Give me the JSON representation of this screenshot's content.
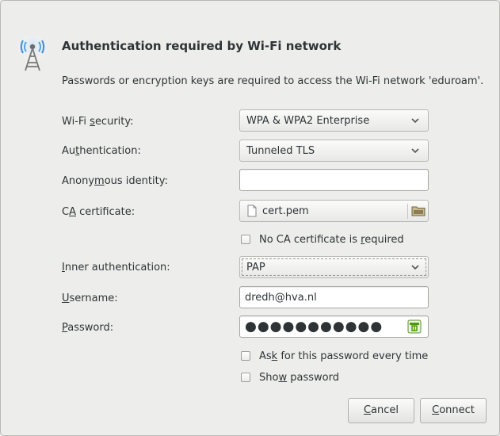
{
  "dialog": {
    "title": "Authentication required by Wi-Fi network",
    "subtitle": "Passwords or encryption keys are required to access the Wi-Fi network 'eduroam'."
  },
  "icons": {
    "header": "wireless-access-point-icon",
    "combo_arrow": "chevron-down-icon",
    "file": "document-icon",
    "folder": "folder-icon",
    "password_toggle": "keyboard-icon"
  },
  "form": {
    "wifi_security": {
      "label_pre": "Wi-Fi ",
      "label_u": "s",
      "label_post": "ecurity:",
      "value": "WPA & WPA2 Enterprise"
    },
    "authentication": {
      "label_pre": "Au",
      "label_u": "t",
      "label_post": "hentication:",
      "value": "Tunneled TLS"
    },
    "anonymous_identity": {
      "label_pre": "Anony",
      "label_u": "m",
      "label_post": "ous identity:",
      "value": ""
    },
    "ca_certificate": {
      "label_pre": "C",
      "label_u": "A",
      "label_post": " certificate:",
      "value": "cert.pem"
    },
    "no_ca_required": {
      "label_pre": "No CA certificate is ",
      "label_u": "r",
      "label_post": "equired",
      "checked": false
    },
    "inner_authentication": {
      "label_pre": "",
      "label_u": "I",
      "label_post": "nner authentication:",
      "value": "PAP"
    },
    "username": {
      "label_pre": "",
      "label_u": "U",
      "label_post": "sername:",
      "value": "dredh@hva.nl"
    },
    "password": {
      "label_pre": "",
      "label_u": "P",
      "label_post": "assword:",
      "value": "●●●●●●●●●●●"
    },
    "ask_password": {
      "label_pre": "As",
      "label_u": "k",
      "label_post": " for this password every time",
      "checked": false
    },
    "show_password": {
      "label_pre": "Sho",
      "label_u": "w",
      "label_post": " password",
      "checked": false
    }
  },
  "buttons": {
    "cancel": {
      "label_pre": "",
      "label_u": "C",
      "label_post": "ancel"
    },
    "connect": {
      "label_pre": "",
      "label_u": "C",
      "label_post": "onnect"
    }
  },
  "colors": {
    "background": "#ededeb",
    "text": "#2e3436",
    "border": "#b8b8b5",
    "icon_blue": "#3a7fc1"
  }
}
